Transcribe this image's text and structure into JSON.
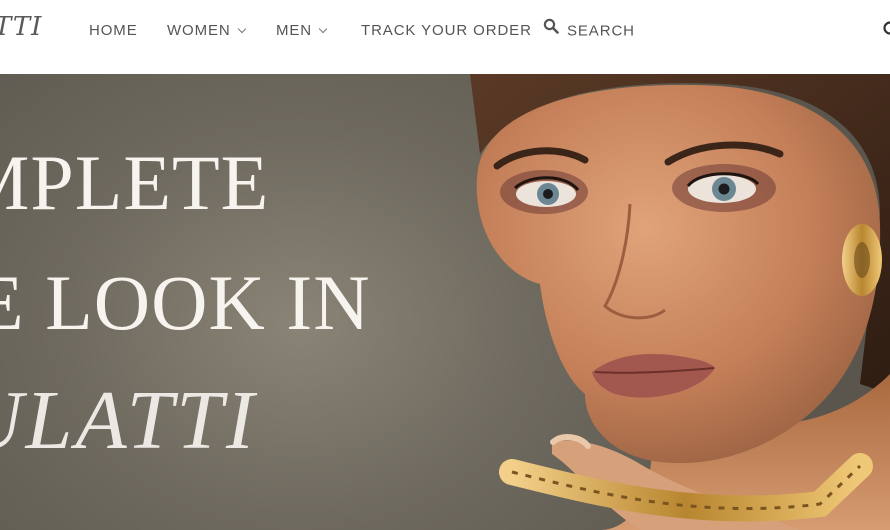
{
  "header": {
    "logo_text": "TTI",
    "nav": [
      {
        "label": "HOME",
        "has_dropdown": false
      },
      {
        "label": "WOMEN",
        "has_dropdown": true
      },
      {
        "label": "MEN",
        "has_dropdown": true
      },
      {
        "label": "TRACK YOUR ORDER",
        "has_dropdown": false
      },
      {
        "label": "SEARCH",
        "icon": "search-icon"
      }
    ]
  },
  "hero": {
    "line1": "MPLETE",
    "line2": "E LOOK IN",
    "line3": "ULATTI",
    "image": "woman-with-gold-jewelry-portrait"
  },
  "colors": {
    "nav_text": "#555555",
    "hero_bg": "#6f6a5f",
    "hero_text": "#f7f4ef"
  }
}
